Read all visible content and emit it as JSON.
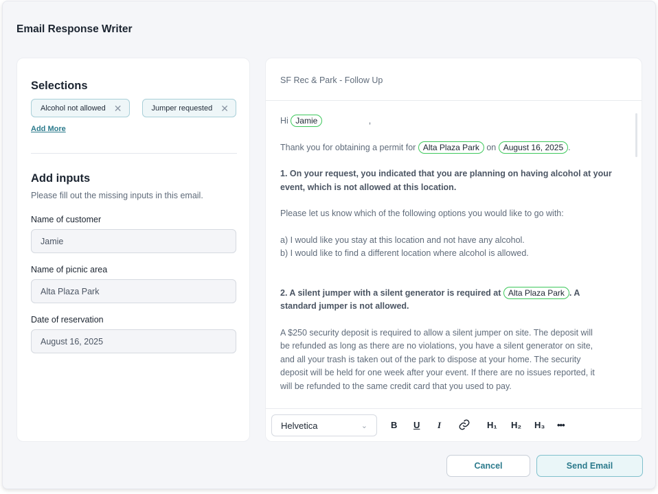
{
  "app": {
    "title": "Email Response Writer"
  },
  "selections": {
    "title": "Selections",
    "chips": [
      {
        "label": "Alcohol not allowed"
      },
      {
        "label": "Jumper requested"
      }
    ],
    "add_more": "Add More"
  },
  "inputs": {
    "title": "Add inputs",
    "subtitle": "Please fill out the missing inputs in this email.",
    "fields": [
      {
        "label": "Name of customer",
        "value": "Jamie"
      },
      {
        "label": "Name of picnic area",
        "value": "Alta Plaza Park"
      },
      {
        "label": "Date of reservation",
        "value": "August 16, 2025"
      }
    ]
  },
  "email": {
    "subject": "SF Rec & Park - Follow Up",
    "greeting": "Hi",
    "customer": "Jamie",
    "greeting_comma": ",",
    "thanks_prefix": "Thank you for obtaining a permit for",
    "park": "Alta Plaza Park",
    "on": "on",
    "date": "August 16, 2025",
    "period": ".",
    "section1_line1": "1.  On your request, you indicated that you are planning on having alcohol at your",
    "section1_line2": "event, which is not allowed at this location.",
    "options_intro": "Please let us know which of the following options you would like to go with:",
    "option_a": "a)  I would like you stay at this location and not have any alcohol.",
    "option_b": "b)  I would like to find a different location where alcohol is allowed.",
    "section2_prefix": "2.  A silent jumper with a silent generator is required at",
    "section2_suffix": ". A",
    "section2_line2": "standard jumper is not allowed.",
    "deposit_lines": [
      "A $250 security deposit is required to allow a silent jumper on site. The deposit will",
      "be refunded as long as there are no violations, you have a silent generator on site,",
      "and all your trash is taken out of the park to dispose at your home. The security",
      "deposit will be held for one week after your event. If there are no issues reported, it",
      "will be refunded to the same credit card that you used to pay."
    ]
  },
  "toolbar": {
    "font": "Helvetica",
    "bold": "B",
    "underline": "U",
    "italic": "I",
    "h1": "H₁",
    "h2": "H₂",
    "h3": "H₃",
    "more": "•••"
  },
  "actions": {
    "cancel": "Cancel",
    "send": "Send Email"
  },
  "colors": {
    "accent": "#2b7a8c",
    "pill_border": "#3cc75a",
    "chip_bg": "#eef6f8"
  }
}
